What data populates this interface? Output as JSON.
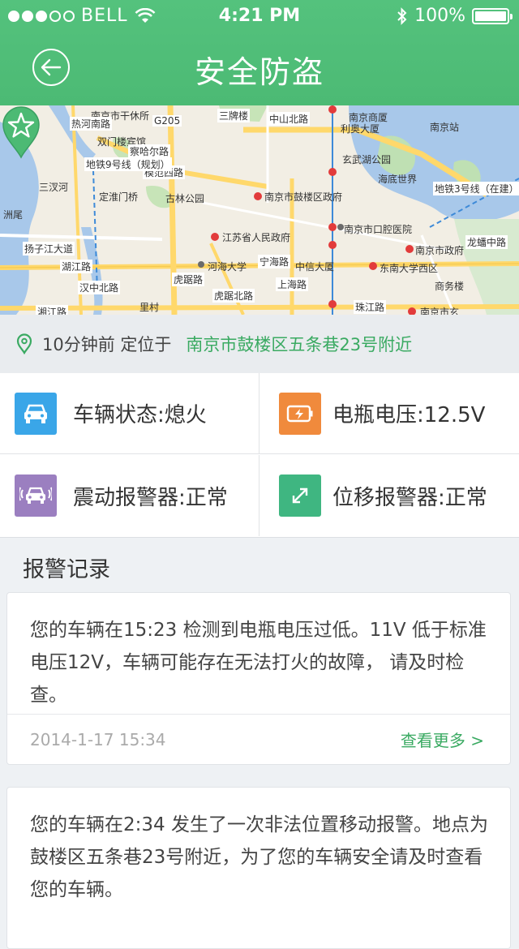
{
  "status_bar": {
    "carrier": "BELL",
    "time": "4:21 PM",
    "battery": "100%",
    "battery_level": 1.0
  },
  "header": {
    "title": "安全防盗"
  },
  "map": {
    "labels": {
      "l1": "南京市干休所",
      "l2": "双门楼宾馆",
      "l3": "热河南路",
      "l4": "G205",
      "l5": "三牌楼",
      "l6": "利奥大厦",
      "l7": "玄武湖公园",
      "l8": "海底世界",
      "l9": "三汊河",
      "l10": "定淮门桥",
      "l11": "古林公园",
      "l12": "南京市鼓楼区政府",
      "l13": "江苏省人民政府",
      "l14": "南京市口腔医院",
      "l15": "南京市政府",
      "l16": "河海大学",
      "l17": "中信大厦",
      "l18": "东南大学西区",
      "l19": "商务楼",
      "l20": "扬子江大道",
      "l21": "湖江路",
      "l22": "汉中北路",
      "l23": "里村",
      "l24": "珠江路",
      "l25": "南京市玄",
      "l26": "地铁3号线（在建）",
      "l27": "湘江路",
      "l28": "洲尾",
      "l29": "龙蟠中路",
      "l30": "模范西路",
      "l31": "中山北路",
      "l32": "虎踞路",
      "l33": "上海路",
      "l34": "南京站",
      "l35": "南京商厦",
      "l36": "察哈尔路",
      "l37": "地铁9号线（规划）",
      "l38": "宁海路",
      "l39": "虎踞北路"
    }
  },
  "location": {
    "time_text": "10分钟前 定位于",
    "address": "南京市鼓楼区五条巷23号附近"
  },
  "status": {
    "vehicle": "车辆状态:熄火",
    "battery": "电瓶电压:12.5V",
    "vibration": "震动报警器:正常",
    "displacement": "位移报警器:正常"
  },
  "colors": {
    "green": "#4cba74",
    "blue_icon": "#3aa6e8",
    "orange_icon": "#f08a3c",
    "purple_icon": "#9b7fc0",
    "teal_icon": "#3fb681"
  },
  "alarms": {
    "title": "报警记录",
    "records": [
      {
        "text": "您的车辆在15:23 检测到电瓶电压过低。11V 低于标准电压12V，车辆可能存在无法打火的故障， 请及时检查。",
        "date": "2014-1-17 15:34",
        "more": "查看更多 >"
      },
      {
        "text": "您的车辆在2:34 发生了一次非法位置移动报警。地点为鼓楼区五条巷23号附近，为了您的车辆安全请及时查看您的车辆。"
      }
    ]
  }
}
